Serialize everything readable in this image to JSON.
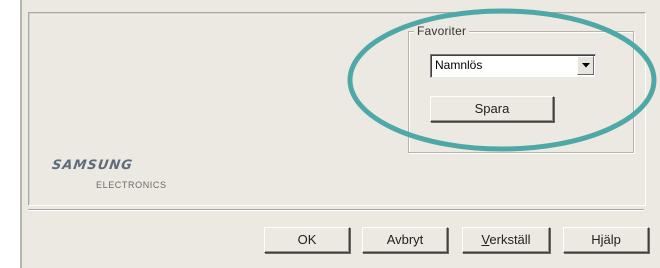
{
  "favorites": {
    "group_title": "Favoriter",
    "selected": "Namnlös",
    "save_label": "Spara"
  },
  "logo": {
    "brand": "SAMSUNG",
    "subtitle": "ELECTRONICS"
  },
  "footer": {
    "ok_label": "OK",
    "cancel_label": "Avbryt",
    "apply_first": "V",
    "apply_rest": "erkställ",
    "help_label": "Hjälp"
  },
  "colors": {
    "dialog_bg": "#ece9e2",
    "highlight_ring": "#4fa8a8"
  }
}
